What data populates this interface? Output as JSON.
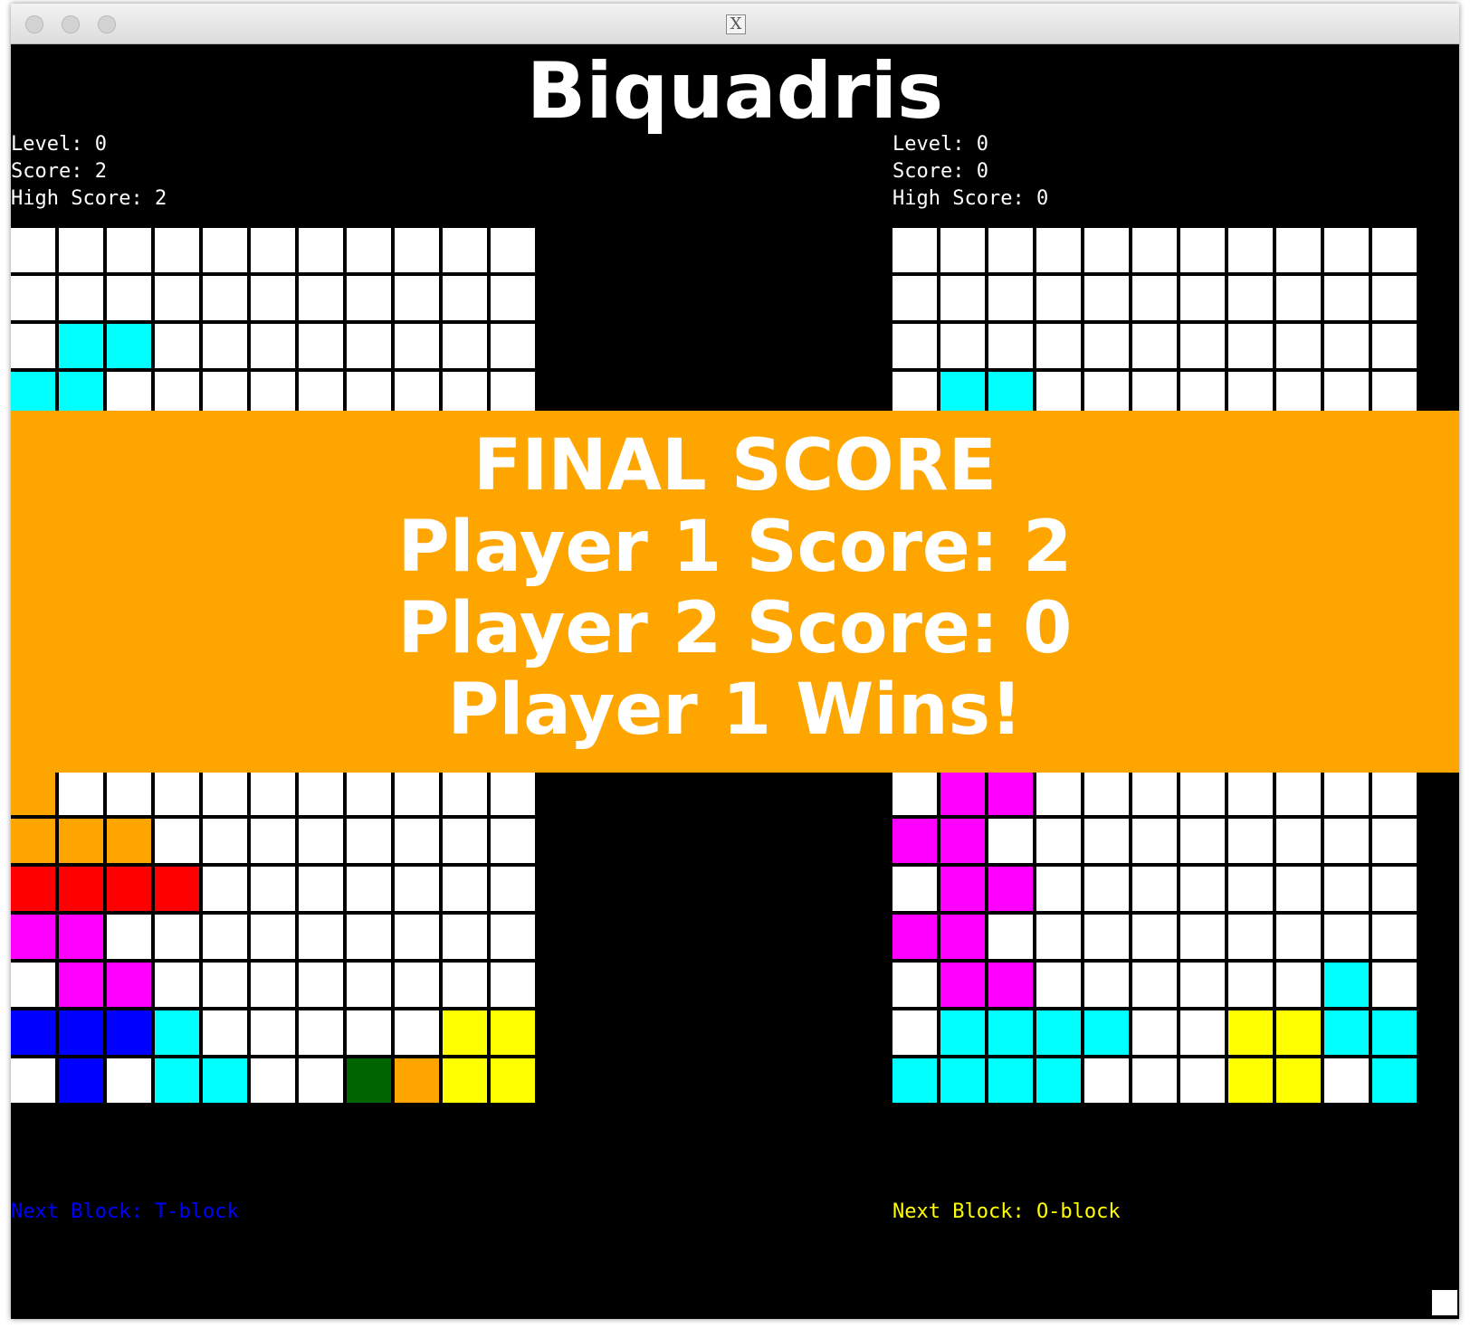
{
  "window": {
    "title_icon": "x11-icon",
    "controls": [
      "close-button",
      "minimize-button",
      "zoom-button"
    ]
  },
  "game": {
    "title": "Biquadris",
    "colors": {
      "W": "#ffffff",
      "C": "#00ffff",
      "O": "#ffa500",
      "R": "#ff0000",
      "M": "#ff00ff",
      "B": "#0000ff",
      "G": "#006400",
      "Y": "#ffff00",
      "background": "#000000"
    },
    "players": [
      {
        "level": "Level: 0",
        "score": "Score: 2",
        "high_score": "High Score: 2",
        "next_block": "Next Block: T-block",
        "next_block_color": "#0000ff",
        "board_top": [
          "WWWWWWWWWWW",
          "WWWWWWWWWWW",
          "WCCWWWWWWWW",
          "CCWWWWWWWWW"
        ],
        "board_bottom": [
          "OWWWWWWWWWW",
          "OOOWWWWWWWW",
          "RRRRWWWWWWW",
          "MMWWWWWWWWW",
          "WMMWWWWWWWW",
          "BBBCWWWWWYY",
          "WBWCCWWGOYY"
        ]
      },
      {
        "level": "Level: 0",
        "score": "Score: 0",
        "high_score": "High Score: 0",
        "next_block": "Next Block: O-block",
        "next_block_color": "#ffff00",
        "board_top": [
          "WWWWWWWWWWW",
          "WWWWWWWWWWW",
          "WWWWWWWWWWW",
          "WCCWWWWWWWW"
        ],
        "board_bottom": [
          "WMMWWWWWWWW",
          "MMWWWWWWWWW",
          "WMMWWWWWWWW",
          "MMWWWWWWWWW",
          "WMMWWWWWWCW",
          "WCCCCWWYYCC",
          "CCCCWWWYYWC"
        ]
      }
    ]
  },
  "final_score": {
    "heading": "FINAL SCORE",
    "player1": "Player 1 Score: 2",
    "player2": "Player 2 Score: 0",
    "result": "Player 1 Wins!"
  }
}
